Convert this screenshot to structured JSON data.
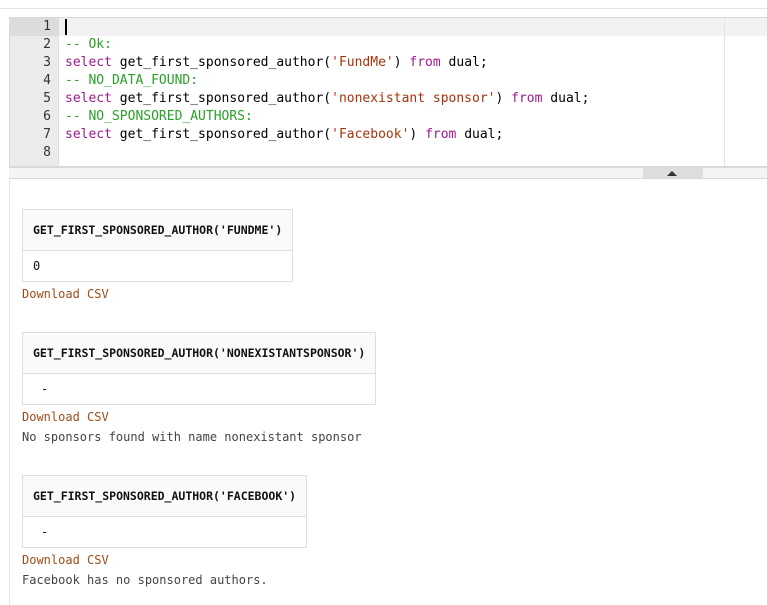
{
  "editor": {
    "line_numbers": [
      "1",
      "2",
      "3",
      "4",
      "5",
      "6",
      "7",
      "8"
    ],
    "lines": [
      [],
      [
        {
          "t": "comment",
          "v": "-- Ok:"
        }
      ],
      [
        {
          "t": "kw",
          "v": "select"
        },
        {
          "t": "plain",
          "v": " get_first_sponsored_author("
        },
        {
          "t": "str",
          "v": "'FundMe'"
        },
        {
          "t": "plain",
          "v": ") "
        },
        {
          "t": "kw",
          "v": "from"
        },
        {
          "t": "plain",
          "v": " dual;"
        }
      ],
      [
        {
          "t": "comment",
          "v": "-- NO_DATA_FOUND:"
        }
      ],
      [
        {
          "t": "kw",
          "v": "select"
        },
        {
          "t": "plain",
          "v": " get_first_sponsored_author("
        },
        {
          "t": "str",
          "v": "'nonexistant sponsor'"
        },
        {
          "t": "plain",
          "v": ") "
        },
        {
          "t": "kw",
          "v": "from"
        },
        {
          "t": "plain",
          "v": " dual;"
        }
      ],
      [
        {
          "t": "comment",
          "v": "-- NO_SPONSORED_AUTHORS:"
        }
      ],
      [
        {
          "t": "kw",
          "v": "select"
        },
        {
          "t": "plain",
          "v": " get_first_sponsored_author("
        },
        {
          "t": "str",
          "v": "'Facebook'"
        },
        {
          "t": "plain",
          "v": ") "
        },
        {
          "t": "kw",
          "v": "from"
        },
        {
          "t": "plain",
          "v": " dual;"
        }
      ],
      []
    ]
  },
  "results": [
    {
      "column": "GET_FIRST_SPONSORED_AUTHOR('FUNDME')",
      "value": "0",
      "download_label": "Download CSV"
    },
    {
      "column": "GET_FIRST_SPONSORED_AUTHOR('NONEXISTANTSPONSOR')",
      "value": "-",
      "download_label": "Download CSV",
      "message": "No sponsors found with name nonexistant sponsor"
    },
    {
      "column": "GET_FIRST_SPONSORED_AUTHOR('FACEBOOK')",
      "value": "-",
      "download_label": "Download CSV",
      "message": "Facebook has no sponsored authors."
    }
  ]
}
